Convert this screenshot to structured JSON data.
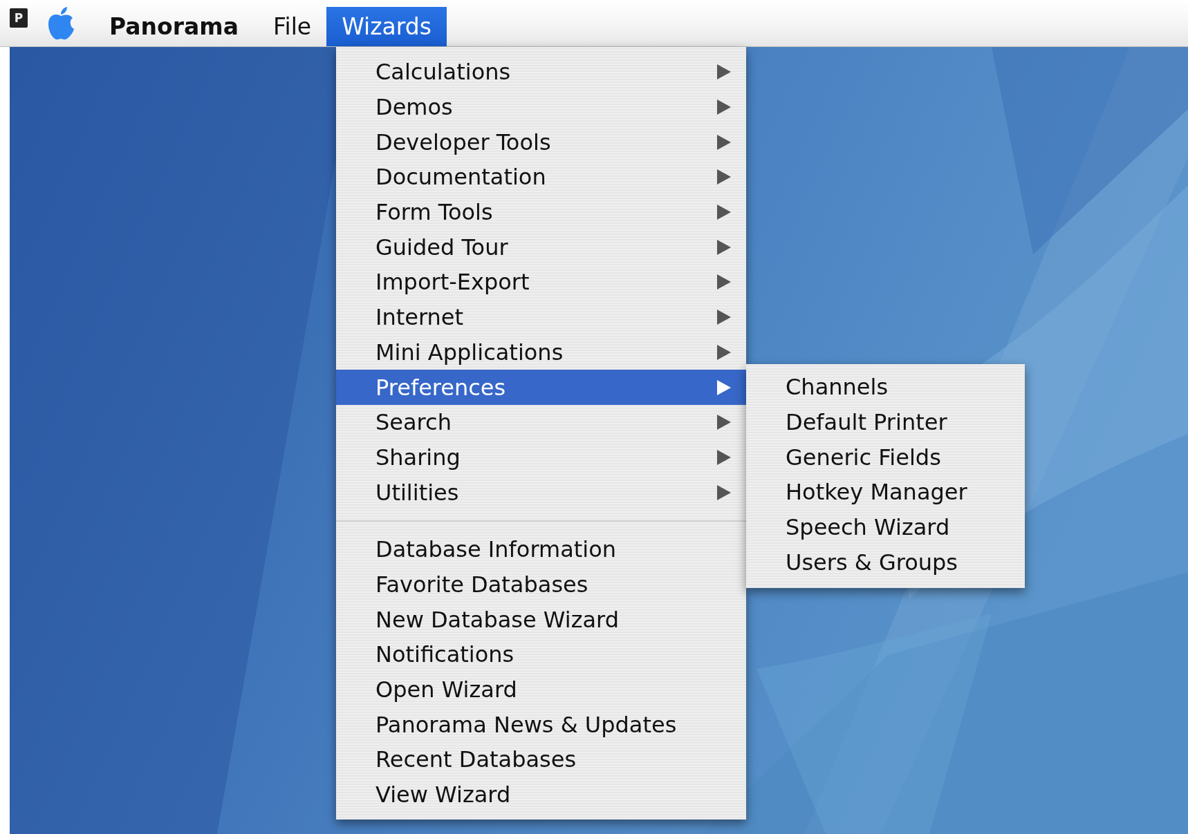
{
  "menu_bar": {
    "app_icon": "P",
    "items": [
      {
        "label": "Panorama",
        "kind": "app",
        "selected": false
      },
      {
        "label": "File",
        "kind": "menu",
        "selected": false
      },
      {
        "label": "Wizards",
        "kind": "menu",
        "selected": true
      }
    ]
  },
  "menu": {
    "sections": [
      {
        "items": [
          {
            "label": "Calculations",
            "has_submenu": true,
            "selected": false
          },
          {
            "label": "Demos",
            "has_submenu": true,
            "selected": false
          },
          {
            "label": "Developer Tools",
            "has_submenu": true,
            "selected": false
          },
          {
            "label": "Documentation",
            "has_submenu": true,
            "selected": false
          },
          {
            "label": "Form Tools",
            "has_submenu": true,
            "selected": false
          },
          {
            "label": "Guided Tour",
            "has_submenu": true,
            "selected": false
          },
          {
            "label": "Import-Export",
            "has_submenu": true,
            "selected": false
          },
          {
            "label": "Internet",
            "has_submenu": true,
            "selected": false
          },
          {
            "label": "Mini Applications",
            "has_submenu": true,
            "selected": false
          },
          {
            "label": "Preferences",
            "has_submenu": true,
            "selected": true
          },
          {
            "label": "Search",
            "has_submenu": true,
            "selected": false
          },
          {
            "label": "Sharing",
            "has_submenu": true,
            "selected": false
          },
          {
            "label": "Utilities",
            "has_submenu": true,
            "selected": false
          }
        ]
      },
      {
        "items": [
          {
            "label": "Database Information",
            "has_submenu": false,
            "selected": false
          },
          {
            "label": "Favorite Databases",
            "has_submenu": false,
            "selected": false
          },
          {
            "label": "New Database Wizard",
            "has_submenu": false,
            "selected": false
          },
          {
            "label": "Notifications",
            "has_submenu": false,
            "selected": false
          },
          {
            "label": "Open Wizard",
            "has_submenu": false,
            "selected": false
          },
          {
            "label": "Panorama News & Updates",
            "has_submenu": false,
            "selected": false
          },
          {
            "label": "Recent Databases",
            "has_submenu": false,
            "selected": false
          },
          {
            "label": "View Wizard",
            "has_submenu": false,
            "selected": false
          }
        ]
      }
    ]
  },
  "submenu": {
    "items": [
      {
        "label": "Channels",
        "selected": false
      },
      {
        "label": "Default Printer",
        "selected": false
      },
      {
        "label": "Generic Fields",
        "selected": false
      },
      {
        "label": "Hotkey Manager",
        "selected": false
      },
      {
        "label": "Speech Wizard",
        "selected": false
      },
      {
        "label": "Users & Groups",
        "selected": false
      }
    ]
  }
}
